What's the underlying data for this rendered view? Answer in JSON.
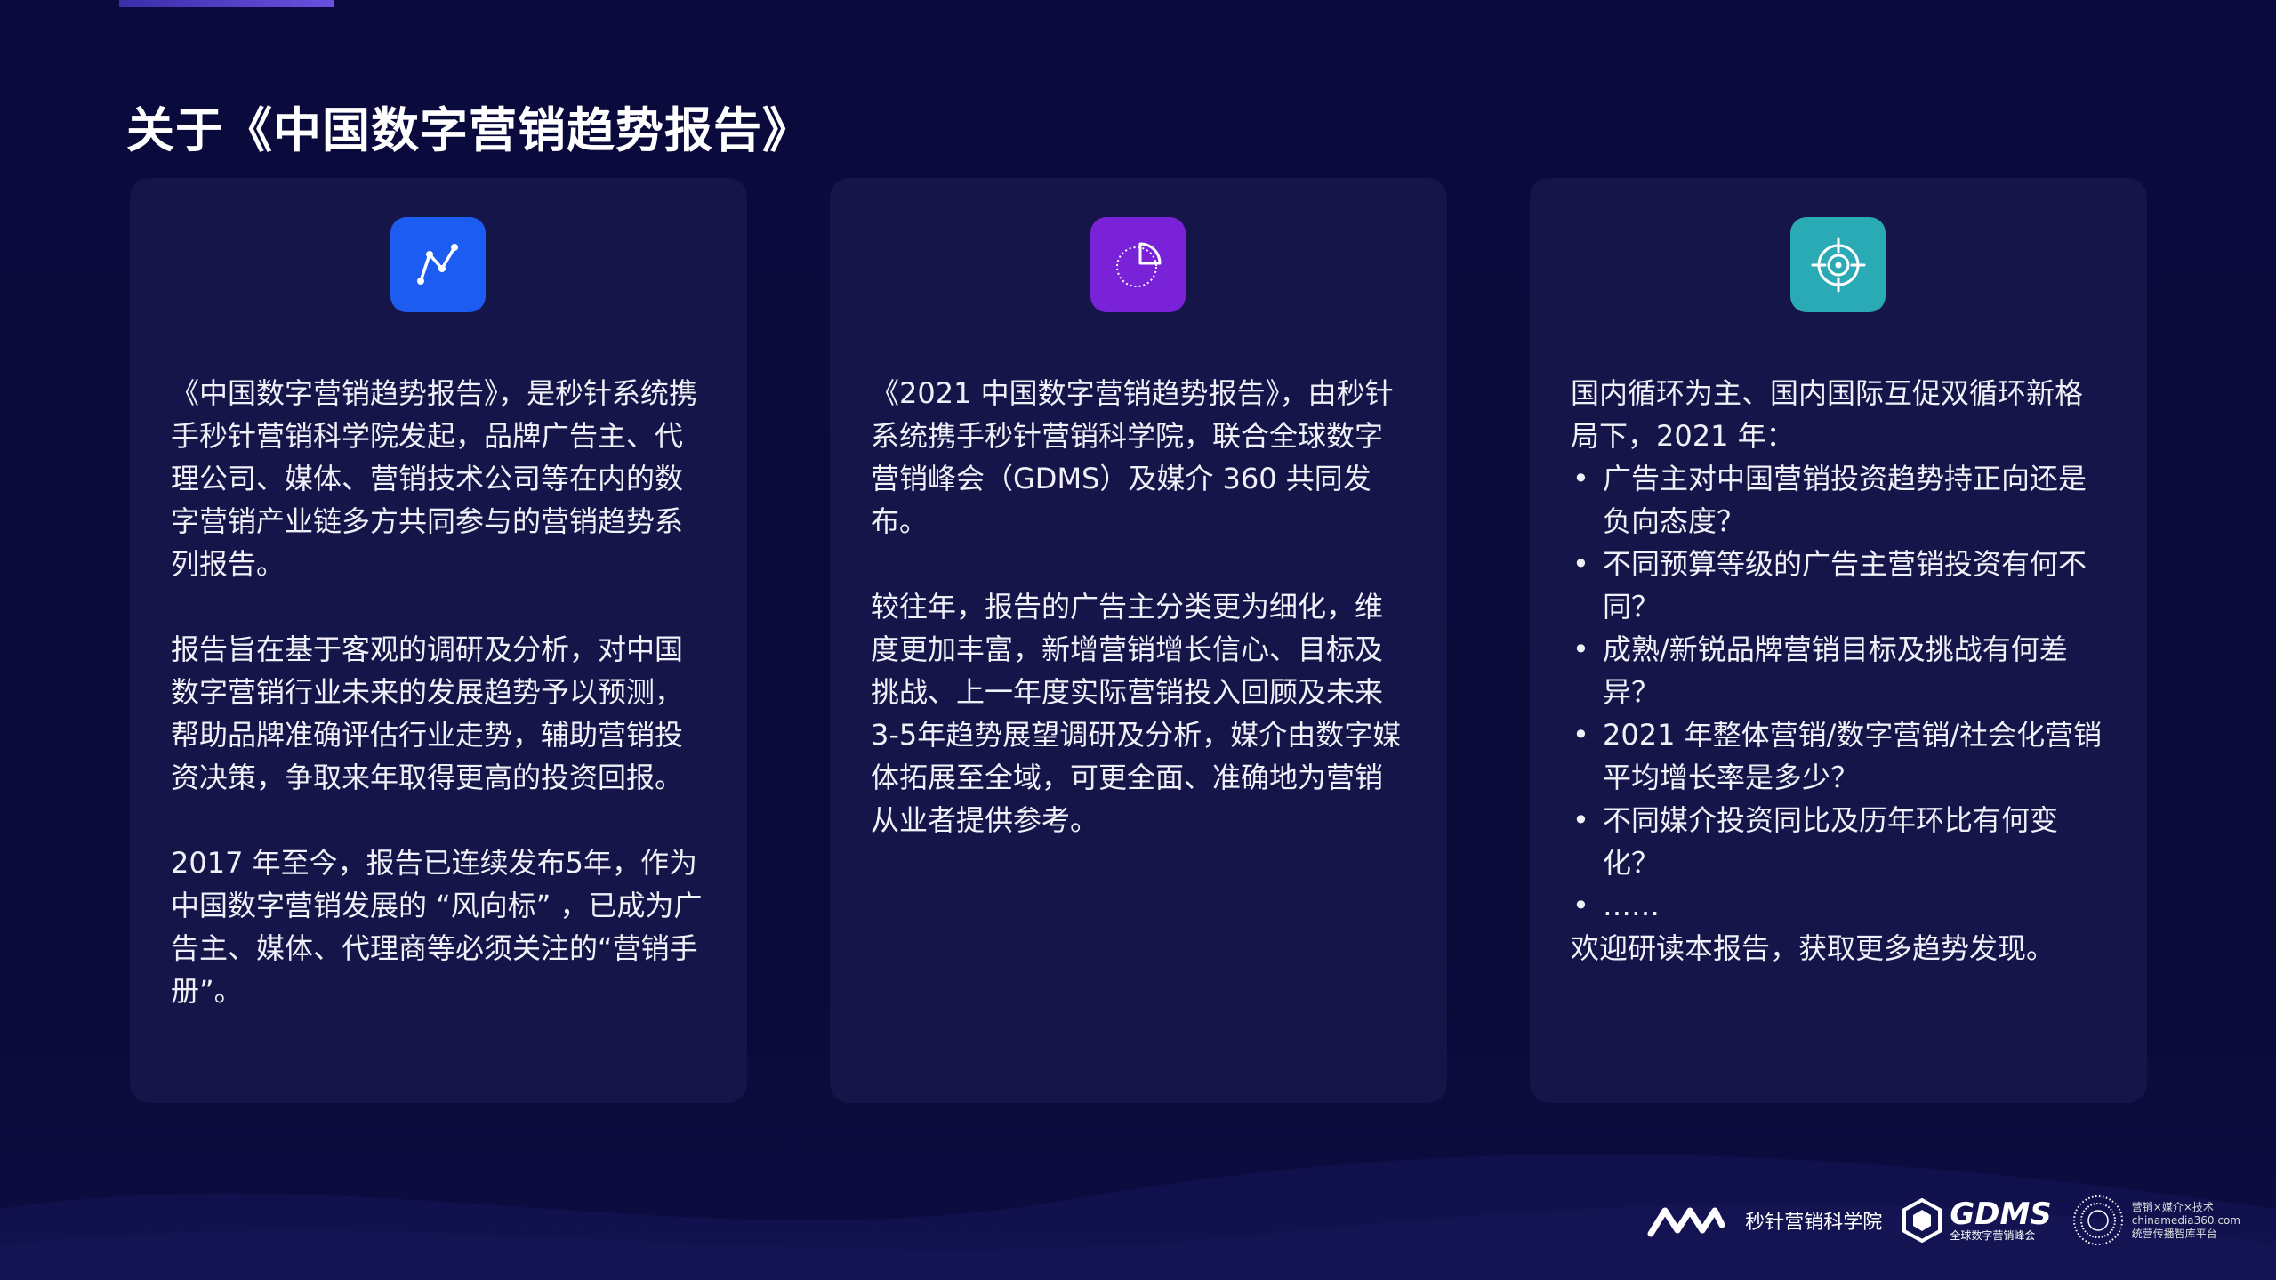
{
  "title": "关于《中国数字营销趋势报告》",
  "colors": {
    "background": "#0a0a3a",
    "card": "#15154a",
    "tile_blue": "#1c5cf0",
    "tile_purple": "#7a22d8",
    "tile_teal": "#2aaab4"
  },
  "cards": [
    {
      "icon": "line-chart-icon",
      "paragraphs": [
        "《中国数字营销趋势报告》，是秒针系统携手秒针营销科学院发起，品牌广告主、代理公司、媒体、营销技术公司等在内的数字营销产业链多方共同参与的营销趋势系列报告。",
        "报告旨在基于客观的调研及分析，对中国数字营销行业未来的发展趋势予以预测，帮助品牌准确评估行业走势，辅助营销投资决策，争取来年取得更高的投资回报。",
        "2017 年至今，报告已连续发布5年，作为中国数字营销发展的 “风向标” ，已成为广告主、媒体、代理商等必须关注的“营销手册”。"
      ]
    },
    {
      "icon": "pie-chart-icon",
      "paragraphs": [
        "《2021 中国数字营销趋势报告》，由秒针系统携手秒针营销科学院，联合全球数字营销峰会（GDMS）及媒介 360 共同发布。",
        "较往年，报告的广告主分类更为细化，维度更加丰富，新增营销增长信心、目标及挑战、上一年度实际营销投入回顾及未来3-5年趋势展望调研及分析，媒介由数字媒体拓展至全域，可更全面、准确地为营销从业者提供参考。"
      ]
    },
    {
      "icon": "target-icon",
      "intro": "国内循环为主、国内国际互促双循环新格局下，2021 年：",
      "bullets": [
        "广告主对中国营销投资趋势持正向还是负向态度？",
        "不同预算等级的广告主营销投资有何不同？",
        "成熟/新锐品牌营销目标及挑战有何差异？",
        "2021 年整体营销/数字营销/社会化营销平均增长率是多少？",
        "不同媒介投资同比及历年环比有何变化？",
        "……"
      ],
      "outro": "欢迎研读本报告，获取更多趋势发现。"
    }
  ],
  "footer": {
    "miaozhen_logo": "miaozhen-logo-icon",
    "miaozhen_text": "秒针营销科学院",
    "gdms_logo": "gdms-logo-icon",
    "gdms_name": "GDMS",
    "gdms_sub": "全球数字营销峰会",
    "media_logo": "media360-logo-icon",
    "media_line1": "营销×媒介×技术",
    "media_line2": "chinamedia360.com",
    "media_line3": "统营传播智库平台"
  }
}
